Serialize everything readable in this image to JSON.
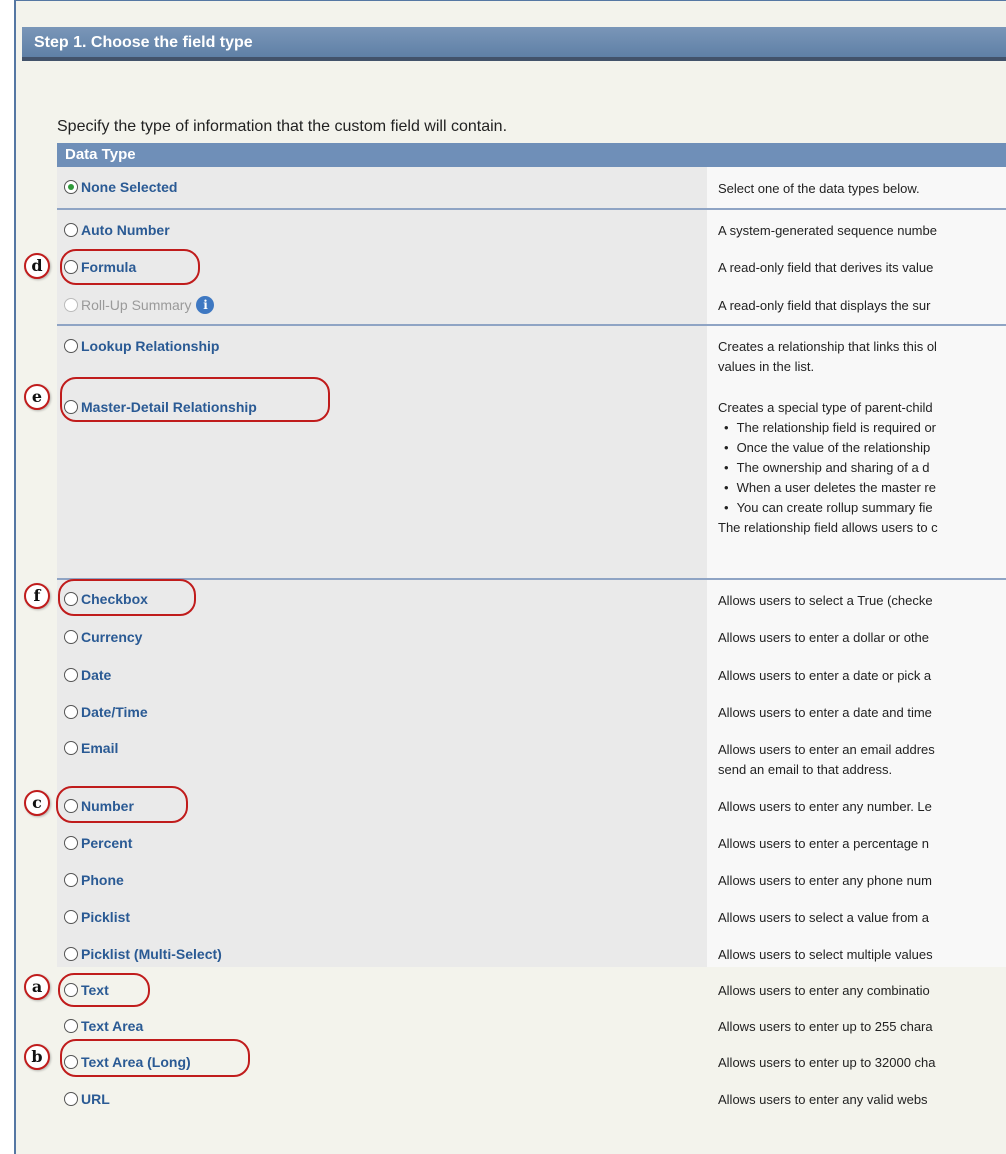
{
  "step_title": "Step 1. Choose the field type",
  "intro": "Specify the type of information that the custom field will contain.",
  "data_type_header": "Data Type",
  "options": [
    {
      "label": "None Selected",
      "desc": "Select one of the data types below.",
      "selected": true
    },
    {
      "label": "Auto Number",
      "desc": "A system-generated sequence numbe"
    },
    {
      "label": "Formula",
      "desc": "A read-only field that derives its value"
    },
    {
      "label": "Roll-Up Summary",
      "desc": "A read-only field that displays the sur",
      "disabled": true
    },
    {
      "label": "Lookup Relationship",
      "desc": "Creates a relationship that links this ol",
      "desc2": "values in the list."
    },
    {
      "label": "Master-Detail Relationship",
      "desc": "Creates a special type of parent-child",
      "bullets": [
        "The relationship field is required or",
        "Once the value of the relationship",
        "The ownership and sharing of a d",
        "When a user deletes the master re",
        "You can create rollup summary fie"
      ],
      "desc_after": "The relationship field allows users to c"
    },
    {
      "label": "Checkbox",
      "desc": "Allows users to select a True (checke"
    },
    {
      "label": "Currency",
      "desc": "Allows users to enter a dollar or othe"
    },
    {
      "label": "Date",
      "desc": "Allows users to enter a date or pick a"
    },
    {
      "label": "Date/Time",
      "desc": "Allows users to enter a date and time"
    },
    {
      "label": "Email",
      "desc": "Allows users to enter an email addres",
      "desc2": "send an email to that address."
    },
    {
      "label": "Number",
      "desc": "Allows users to enter any number. Le"
    },
    {
      "label": "Percent",
      "desc": "Allows users to enter a percentage n"
    },
    {
      "label": "Phone",
      "desc": "Allows users to enter any phone num"
    },
    {
      "label": "Picklist",
      "desc": "Allows users to select a value from a"
    },
    {
      "label": "Picklist (Multi-Select)",
      "desc": "Allows users to select multiple values"
    },
    {
      "label": "Text",
      "desc": "Allows users to enter any combinatio"
    },
    {
      "label": "Text Area",
      "desc": "Allows users to enter up to 255 chara"
    },
    {
      "label": "Text Area (Long)",
      "desc": "Allows users to enter up to 32000 cha"
    },
    {
      "label": "URL",
      "desc": "Allows users to enter any valid webs"
    }
  ],
  "callouts": [
    "d",
    "e",
    "f",
    "c",
    "a",
    "b"
  ],
  "colors": {
    "annotation": "#c01c1c",
    "header": "#5f80a6",
    "link": "#2a5a94",
    "radio_checked": "#2f9a3a"
  },
  "icons": {
    "info": "info-icon"
  }
}
